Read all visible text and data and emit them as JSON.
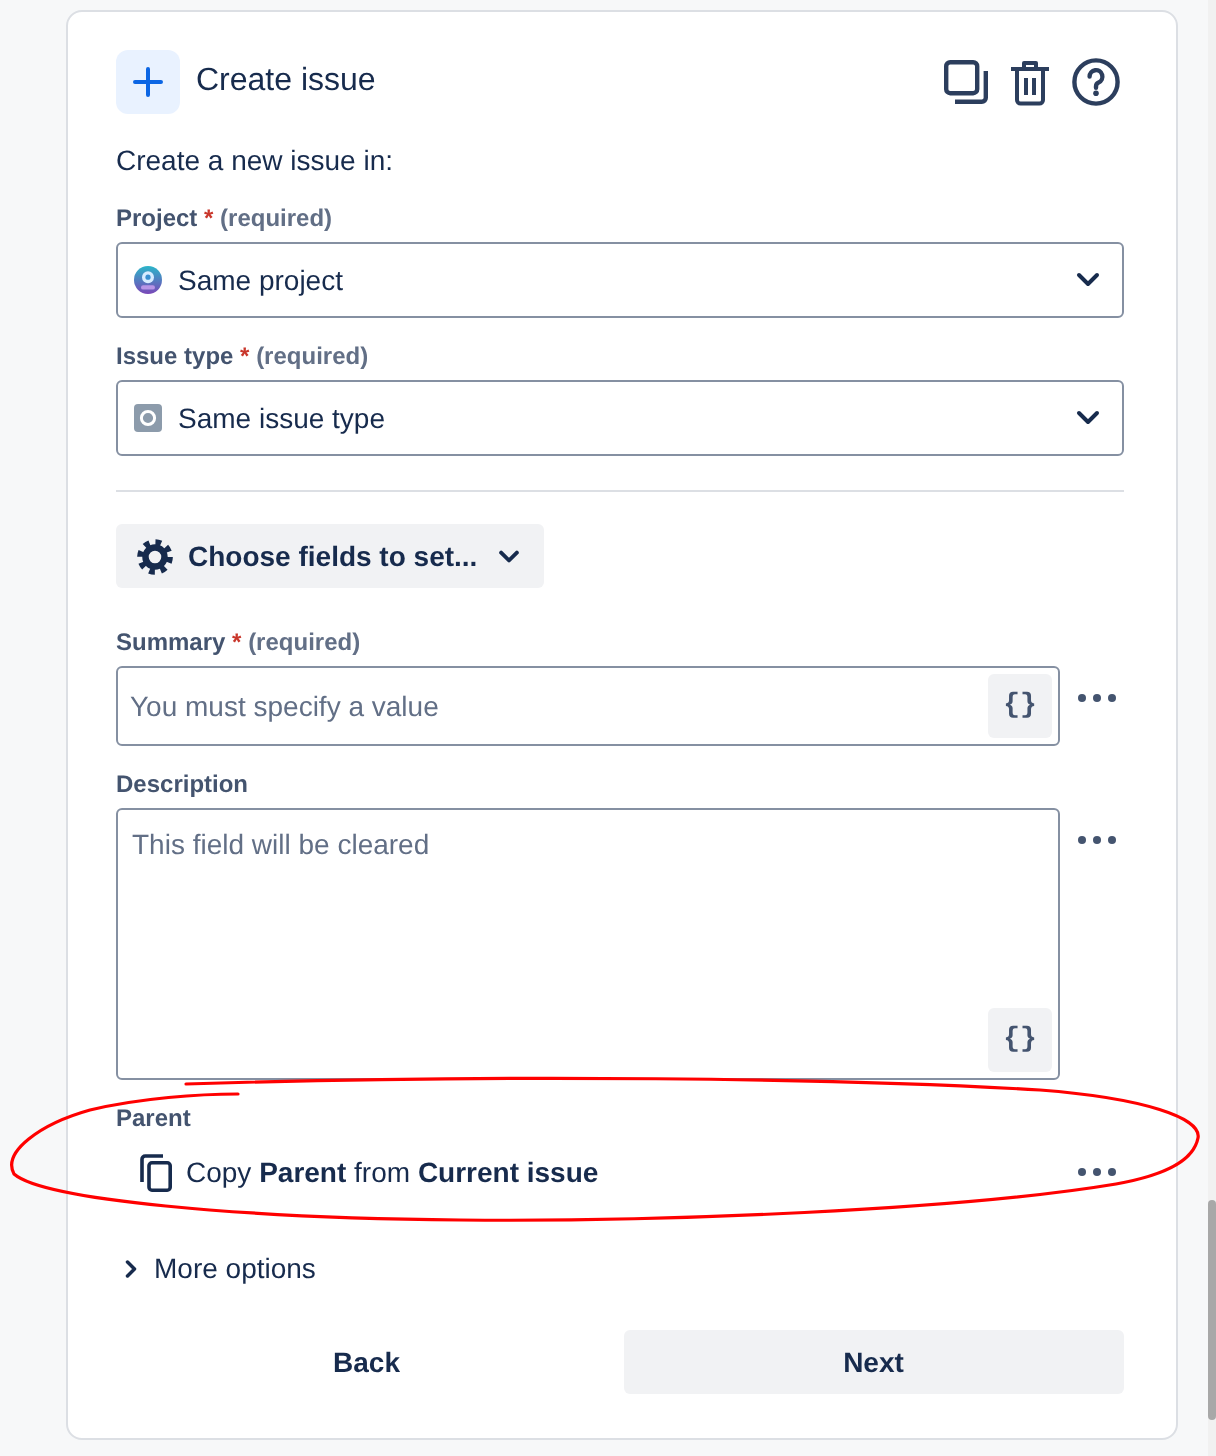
{
  "header": {
    "title": "Create issue"
  },
  "intro": "Create a new issue in:",
  "location_fields": [
    {
      "kind": "project",
      "label": "Project",
      "required_mark": "*",
      "required_note": "(required)",
      "value": "Same project"
    },
    {
      "kind": "issue_type",
      "label": "Issue type",
      "required_mark": "*",
      "required_note": "(required)",
      "value": "Same issue type"
    }
  ],
  "choose_fields_button": {
    "label": "Choose fields to set..."
  },
  "set_fields": [
    {
      "kind": "text",
      "label": "Summary",
      "required_mark": "*",
      "required_note": "(required)",
      "placeholder": "You must specify a value",
      "smart_value_button": "{}"
    },
    {
      "kind": "paragraph",
      "label": "Description",
      "placeholder": "This field will be cleared",
      "smart_value_button": "{}"
    },
    {
      "kind": "copy",
      "label": "Parent",
      "text": "Copy **Parent** from **Current issue**"
    }
  ],
  "more_options": {
    "label": "More options",
    "expanded": false
  },
  "buttons": [
    {
      "kind": "subtle",
      "label": "Back"
    },
    {
      "kind": "default",
      "label": "Next"
    }
  ],
  "annotation": {
    "kind": "freehand_ellipse"
  }
}
